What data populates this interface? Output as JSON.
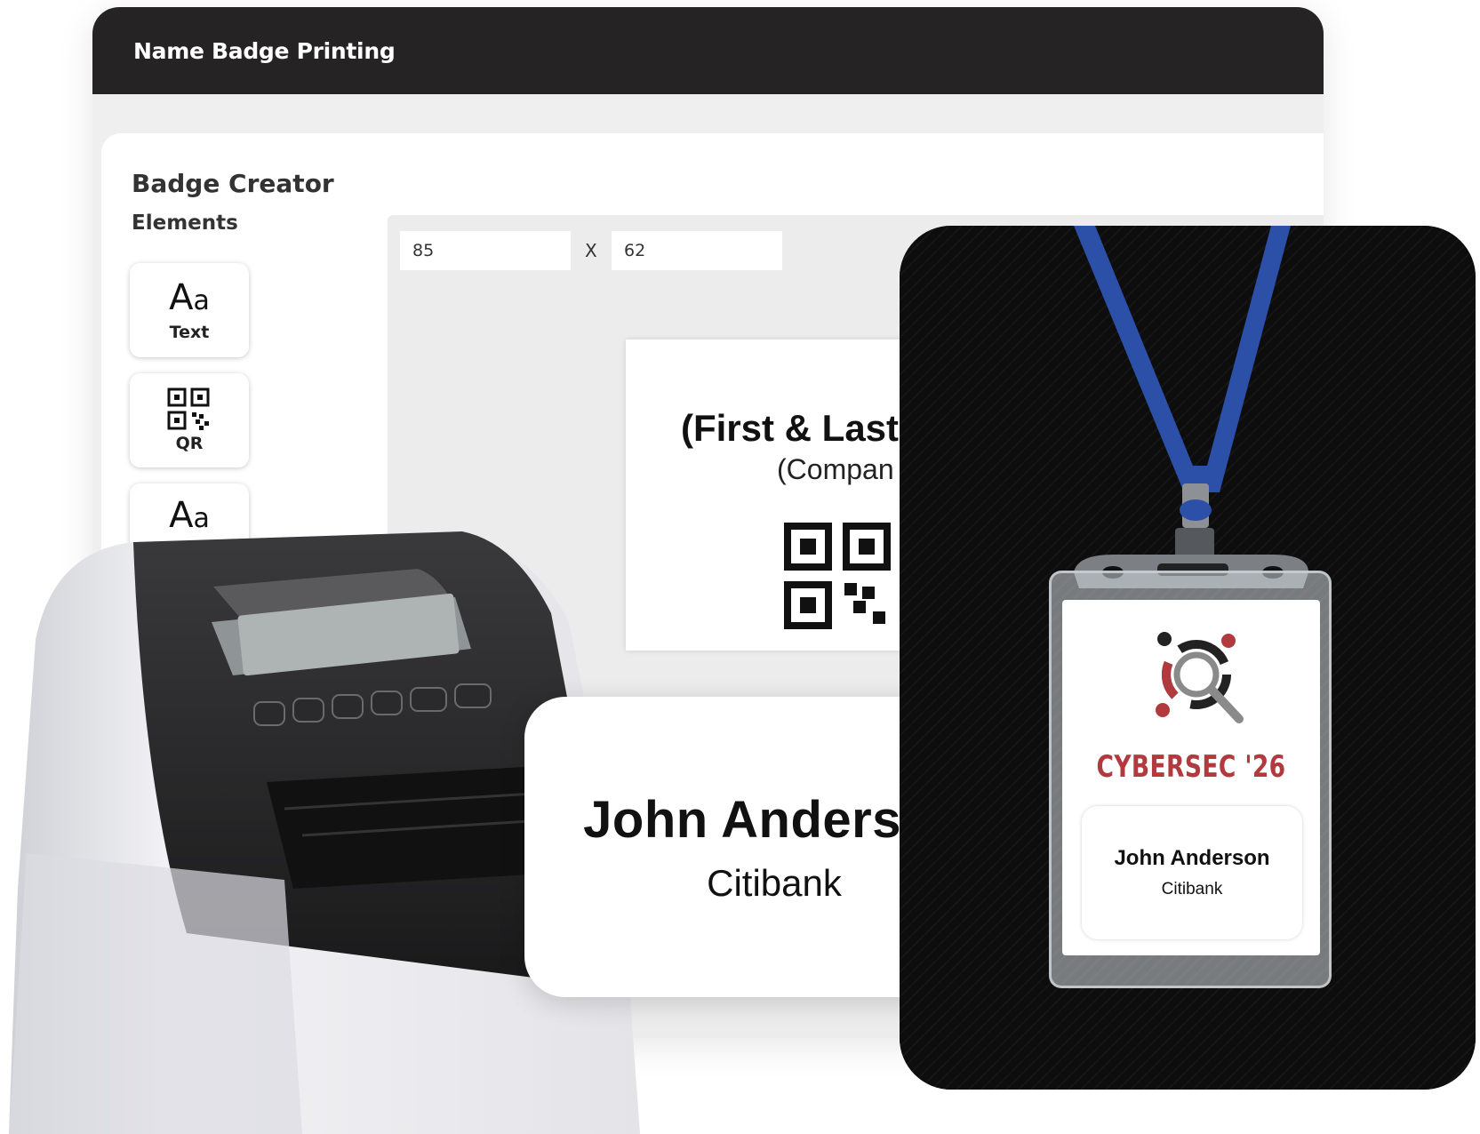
{
  "window": {
    "title": "Name Badge Printing"
  },
  "panel": {
    "title": "Badge Creator",
    "subtitle": "Elements"
  },
  "tools": [
    {
      "label": "Text",
      "glyph_big": "A",
      "glyph_small": "a"
    },
    {
      "label": "QR"
    },
    {
      "glyph_big": "A",
      "glyph_small": "a"
    }
  ],
  "canvas": {
    "width_value": "85",
    "separator": "X",
    "height_value": "62",
    "preview_name": "(First & Last",
    "preview_company": "(Compan"
  },
  "badge": {
    "name": "John Anderson",
    "company": "Citibank"
  },
  "lanyard_badge": {
    "event_title": "CYBERSEC '26",
    "name": "John Anderson",
    "company": "Citibank"
  },
  "colors": {
    "title_bar": "#262324",
    "lanyard": "#2c4fa8",
    "event_accent": "#b13a3f"
  }
}
